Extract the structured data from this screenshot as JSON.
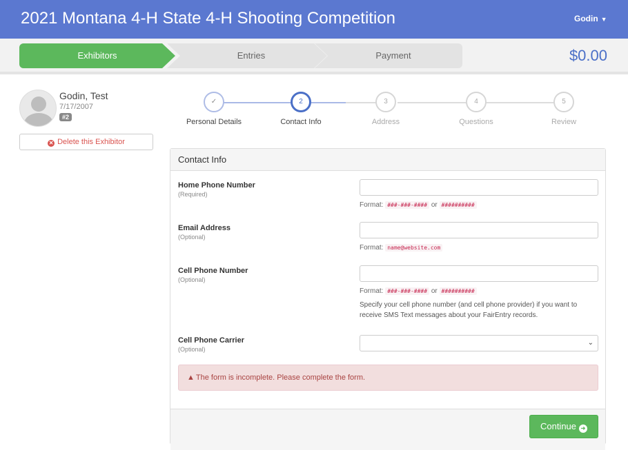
{
  "header": {
    "title": "2021 Montana 4-H State 4-H Shooting Competition",
    "user": "Godin"
  },
  "wizard": {
    "steps": [
      {
        "label": "Exhibitors"
      },
      {
        "label": "Entries"
      },
      {
        "label": "Payment"
      }
    ],
    "total": "$0.00"
  },
  "exhibitor": {
    "name": "Godin, Test",
    "dob": "7/17/2007",
    "badge": "#2",
    "delete_label": "Delete this Exhibitor"
  },
  "stepper": {
    "steps": [
      {
        "num": "✓",
        "label": "Personal Details"
      },
      {
        "num": "2",
        "label": "Contact Info"
      },
      {
        "num": "3",
        "label": "Address"
      },
      {
        "num": "4",
        "label": "Questions"
      },
      {
        "num": "5",
        "label": "Review"
      }
    ]
  },
  "form": {
    "heading": "Contact Info",
    "home_phone": {
      "label": "Home Phone Number",
      "sub": "(Required)",
      "value": "",
      "format_prefix": "Format:",
      "format_a": "###-###-####",
      "format_or": "or",
      "format_b": "##########"
    },
    "email": {
      "label": "Email Address",
      "sub": "(Optional)",
      "value": "",
      "format_prefix": "Format:",
      "format_a": "name@website.com"
    },
    "cell_phone": {
      "label": "Cell Phone Number",
      "sub": "(Optional)",
      "value": "",
      "format_prefix": "Format:",
      "format_a": "###-###-####",
      "format_or": "or",
      "format_b": "##########",
      "note": "Specify your cell phone number (and cell phone provider) if you want to receive SMS Text messages about your FairEntry records."
    },
    "carrier": {
      "label": "Cell Phone Carrier",
      "sub": "(Optional)",
      "value": ""
    },
    "alert": "The form is incomplete. Please complete the form.",
    "continue_label": "Continue"
  },
  "colors": {
    "header": "#5b78d0",
    "success": "#5cb85c",
    "danger": "#d9534f",
    "accent": "#4a6fc7"
  }
}
